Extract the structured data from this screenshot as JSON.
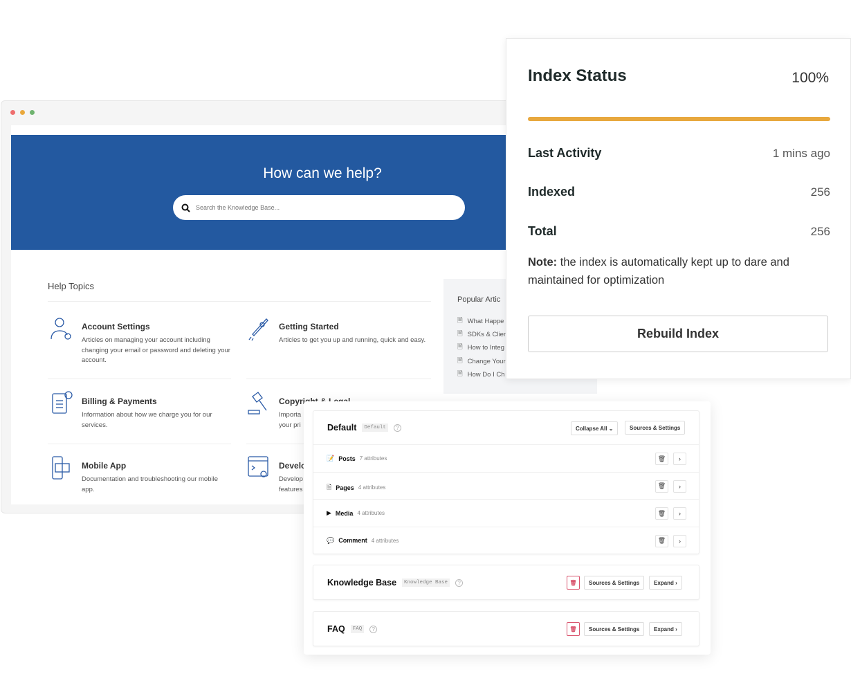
{
  "browser": {
    "dots": [
      "#ee6e6e",
      "#e9a83c",
      "#6fb36f"
    ]
  },
  "hero": {
    "title": "How can we help?",
    "search_placeholder": "Search the Knowledge Base...",
    "color": "#2359a0"
  },
  "help_topics": {
    "heading": "Help Topics",
    "items": [
      {
        "title": "Account Settings",
        "desc": "Articles on managing your account including changing your email or password and deleting your account.",
        "icon": "user-gear-icon"
      },
      {
        "title": "Getting Started",
        "desc": "Articles to get you up and running, quick and easy.",
        "icon": "rocket-icon"
      },
      {
        "title": "Billing & Payments",
        "desc": "Information about how we charge you for our services.",
        "icon": "invoice-icon"
      },
      {
        "title": "Copyright & Legal",
        "desc": "Importa your pri",
        "icon": "gavel-icon"
      },
      {
        "title": "Mobile App",
        "desc": "Documentation and troubleshooting our mobile app.",
        "icon": "mobile-icon"
      },
      {
        "title": "Develo",
        "desc": "Develop features",
        "icon": "code-gear-icon"
      }
    ]
  },
  "popular": {
    "title": "Popular Artic",
    "items": [
      "What Happe",
      "SDKs & Clien",
      "How to Integ",
      "Change Your",
      "How Do I Ch"
    ]
  },
  "index_status": {
    "title": "Index Status",
    "percent": "100%",
    "progress": 100,
    "accent": "#e8a83e",
    "rows": [
      {
        "label": "Last Activity",
        "value": "1 mins ago"
      },
      {
        "label": "Indexed",
        "value": "256"
      },
      {
        "label": "Total",
        "value": "256"
      }
    ],
    "note_label": "Note:",
    "note": " the index is automatically kept up to dare and maintained for optimization",
    "button": "Rebuild Index"
  },
  "indices": {
    "default": {
      "title": "Default",
      "tag": "Default",
      "collapse": "Collapse All",
      "sources": "Sources & Settings",
      "entries": [
        {
          "name": "Posts",
          "attrs": "7 attributes"
        },
        {
          "name": "Pages",
          "attrs": "4 attributes"
        },
        {
          "name": "Media",
          "attrs": "4 attributes"
        },
        {
          "name": "Comment",
          "attrs": "4 attributes"
        }
      ]
    },
    "kb": {
      "title": "Knowledge Base",
      "tag": "Knowledge Base",
      "sources": "Sources & Settings",
      "expand": "Expand"
    },
    "faq": {
      "title": "FAQ",
      "tag": "FAQ",
      "sources": "Sources & Settings",
      "expand": "Expand"
    }
  }
}
